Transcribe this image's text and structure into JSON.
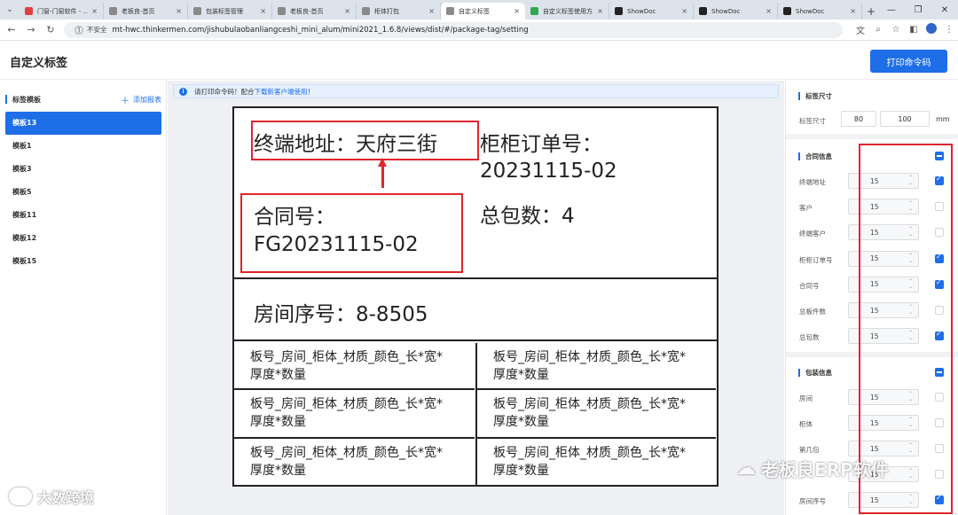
{
  "browser": {
    "tabs": [
      {
        "label": "门窗-门窗软件 - ...",
        "color": "#e04040",
        "active": false
      },
      {
        "label": "老板良-首页",
        "color": "#8a8a8a",
        "active": false
      },
      {
        "label": "包装标签管理",
        "color": "#8a8a8a",
        "active": false
      },
      {
        "label": "老板良-首页",
        "color": "#8a8a8a",
        "active": false
      },
      {
        "label": "柜体打包",
        "color": "#8a8a8a",
        "active": false
      },
      {
        "label": "自定义标签",
        "color": "#8a8a8a",
        "active": true
      },
      {
        "label": "自定义标签使用方...",
        "color": "#2fa84f",
        "active": false
      },
      {
        "label": "ShowDoc",
        "color": "#222222",
        "active": false
      },
      {
        "label": "ShowDoc",
        "color": "#222222",
        "active": false
      },
      {
        "label": "ShowDoc",
        "color": "#222222",
        "active": false
      }
    ],
    "insecure_label": "不安全",
    "url": "mt-hwc.thinkermen.com/jishubulaobanliangceshi_mini_alum/mini2021_1.6.8/views/dist/#/package-tag/setting"
  },
  "header": {
    "title": "自定义标签",
    "print_button": "打印命令码"
  },
  "sidebar": {
    "title": "标签模板",
    "add_label": "添加报表",
    "items": [
      {
        "label": "模板13",
        "active": true
      },
      {
        "label": "模板1",
        "active": false
      },
      {
        "label": "模板3",
        "active": false
      },
      {
        "label": "模板5",
        "active": false
      },
      {
        "label": "模板11",
        "active": false
      },
      {
        "label": "模板12",
        "active": false
      },
      {
        "label": "模板15",
        "active": false
      }
    ]
  },
  "notice": {
    "text_before": "请打印命令码！配合",
    "link": "下载新客户端使用",
    "text_after": "！"
  },
  "label": {
    "address": "终端地址：天府三街",
    "order_label": "柜柜订单号：",
    "order_value": "20231115-02",
    "total_packages": "总包数：4",
    "contract_label": "合同号：",
    "contract_value": "FG20231115-02",
    "room": "房间序号：8-8505",
    "cells": [
      {
        "line1": "板号_房间_柜体_材质_颜色_长*宽*",
        "line2": "厚度*数量"
      },
      {
        "line1": "板号_房间_柜体_材质_颜色_长*宽*",
        "line2": "厚度*数量"
      },
      {
        "line1": "板号_房间_柜体_材质_颜色_长*宽*",
        "line2": "厚度*数量"
      },
      {
        "line1": "板号_房间_柜体_材质_颜色_长*宽*",
        "line2": "厚度*数量"
      },
      {
        "line1": "板号_房间_柜体_材质_颜色_长*宽*",
        "line2": "厚度*数量"
      },
      {
        "line1": "板号_房间_柜体_材质_颜色_长*宽*",
        "line2": "厚度*数量"
      }
    ]
  },
  "panel": {
    "size_section": "标签尺寸",
    "size_label": "标签尺寸",
    "width": "80",
    "height": "100",
    "unit": "mm",
    "contract_section": "合同信息",
    "contract_fields": [
      {
        "label": "终端地址",
        "value": "15",
        "checked": true
      },
      {
        "label": "客户",
        "value": "15",
        "checked": false
      },
      {
        "label": "终端客户",
        "value": "15",
        "checked": false
      },
      {
        "label": "柜柜订单号",
        "value": "15",
        "checked": true
      },
      {
        "label": "合同号",
        "value": "15",
        "checked": true
      },
      {
        "label": "总板件数",
        "value": "15",
        "checked": false
      },
      {
        "label": "总包数",
        "value": "15",
        "checked": true
      }
    ],
    "package_section": "包装信息",
    "package_fields": [
      {
        "label": "房间",
        "value": "15",
        "checked": false
      },
      {
        "label": "柜体",
        "value": "15",
        "checked": false
      },
      {
        "label": "第几包",
        "value": "15",
        "checked": false
      },
      {
        "label": "",
        "value": "15",
        "checked": false
      },
      {
        "label": "房间序号",
        "value": "15",
        "checked": true
      }
    ]
  },
  "watermarks": {
    "right": "老板良ERP软件",
    "left": "大数跨境"
  },
  "colors": {
    "accent": "#1e6ee8",
    "highlight_red": "#e0262b"
  }
}
